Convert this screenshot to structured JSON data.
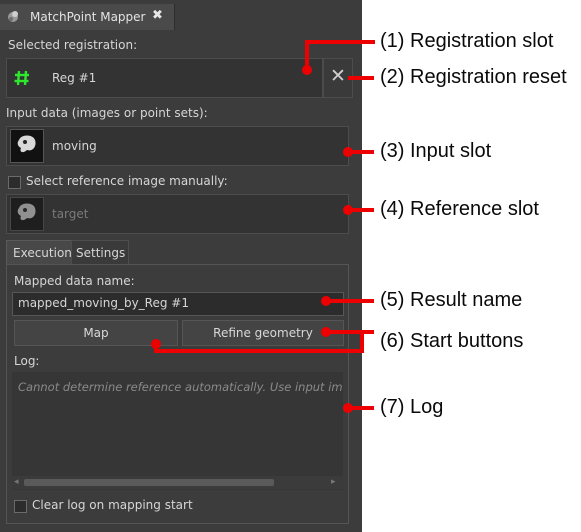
{
  "window": {
    "tab_title": "MatchPoint Mapper",
    "close_glyph": "✖"
  },
  "registration": {
    "label": "Selected registration:",
    "name": "Reg #1",
    "icon": "hash-icon",
    "icon_color": "#2ee82e",
    "reset_glyph": "✕"
  },
  "input": {
    "label": "Input data (images or point sets):",
    "name": "moving"
  },
  "reference": {
    "checkbox_label": "Select reference image manually:",
    "checked": false,
    "name": "target"
  },
  "tabs": [
    {
      "label": "Execution",
      "active": true
    },
    {
      "label": "Settings",
      "active": false
    }
  ],
  "execution": {
    "mapped_label": "Mapped data name:",
    "mapped_value": "mapped_moving_by_Reg #1",
    "map_button": "Map",
    "refine_button": "Refine geometry",
    "log_label": "Log:",
    "log_text": "Cannot determine reference automatically. Use input imag",
    "clear_checkbox_label": "Clear log on mapping start",
    "clear_checked": false
  },
  "callouts": [
    "(1) Registration slot",
    "(2) Registration reset",
    "(3) Input slot",
    "(4) Reference slot",
    "(5) Result name",
    "(6) Start buttons",
    "(7) Log"
  ],
  "colors": {
    "annotation_red": "#ee0000",
    "panel_bg": "#3c3c3c"
  }
}
